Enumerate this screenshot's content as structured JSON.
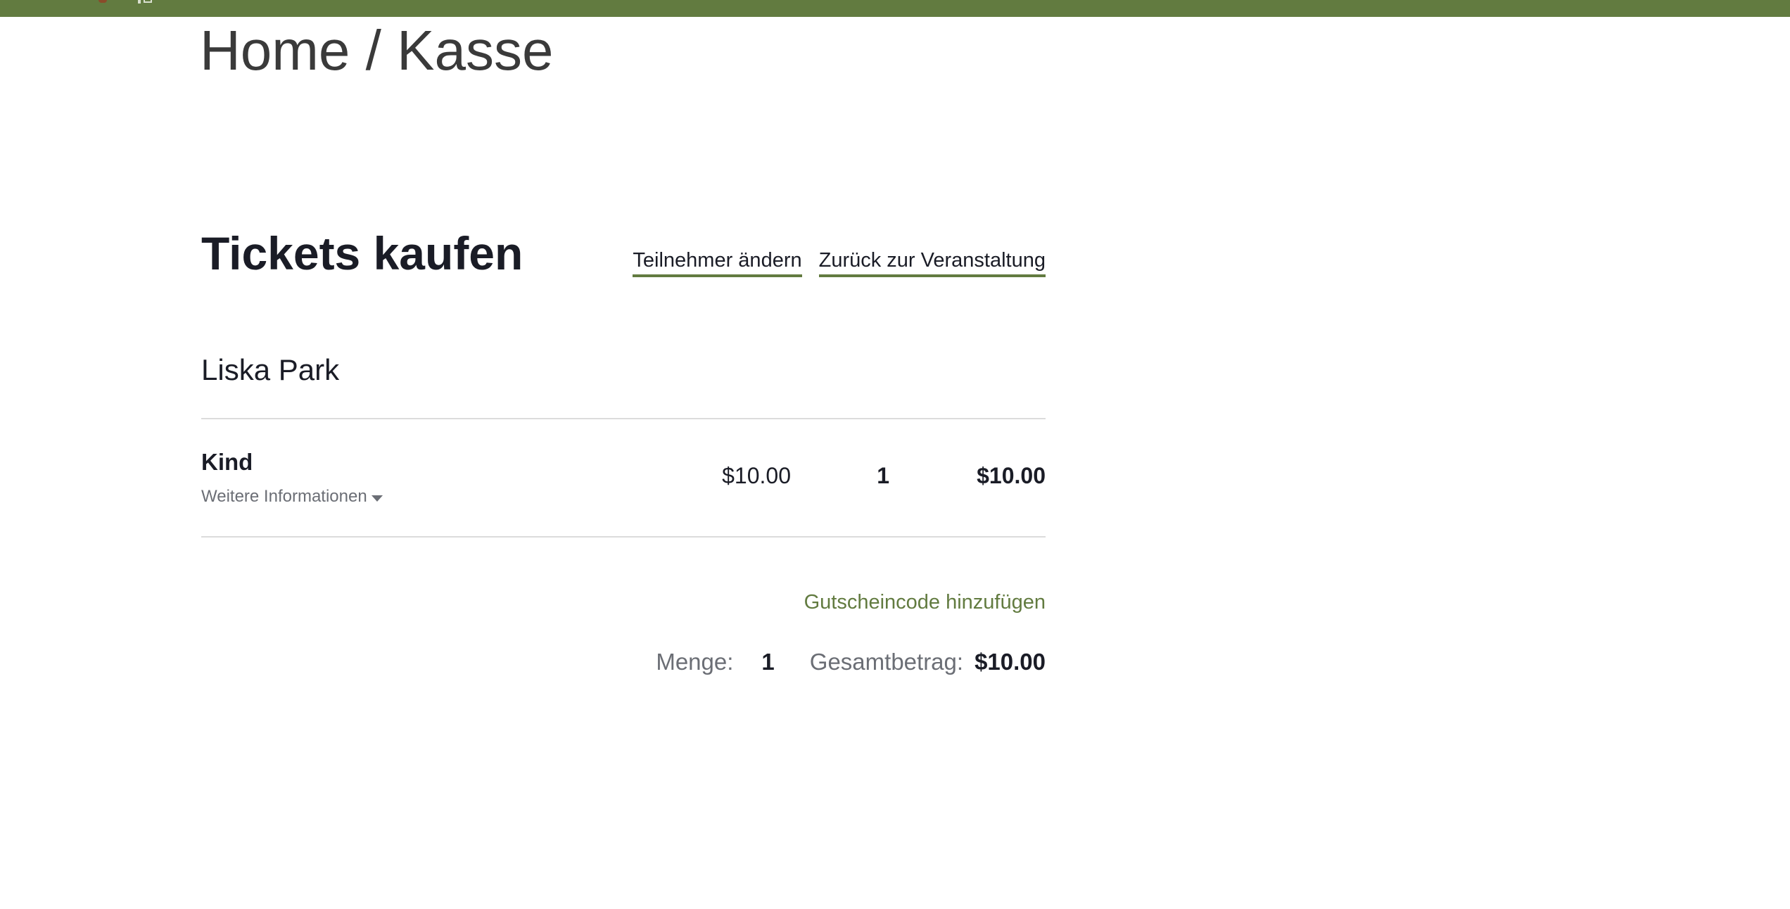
{
  "colors": {
    "brand_green": "#627b40",
    "text_dark": "#1a1c26",
    "text_muted": "#6b6e75",
    "divider": "#dcdcdc"
  },
  "breadcrumb": {
    "home": "Home",
    "separator": " / ",
    "current": "Kasse"
  },
  "checkout": {
    "title": "Tickets kaufen",
    "change_attendees_link": "Teilnehmer ändern",
    "back_to_event_link": "Zurück zur Veranstaltung",
    "event_name": "Liska Park"
  },
  "tickets": [
    {
      "name": "Kind",
      "more_info": "Weitere Informationen",
      "price": "$10.00",
      "quantity": "1",
      "subtotal": "$10.00"
    }
  ],
  "coupon": {
    "link": "Gutscheincode hinzufügen"
  },
  "summary": {
    "quantity_label": "Menge:",
    "quantity_value": "1",
    "total_label": "Gesamtbetrag:",
    "total_value": "$10.00"
  },
  "icons": {
    "more_info_toggle": "caret-down-icon"
  }
}
